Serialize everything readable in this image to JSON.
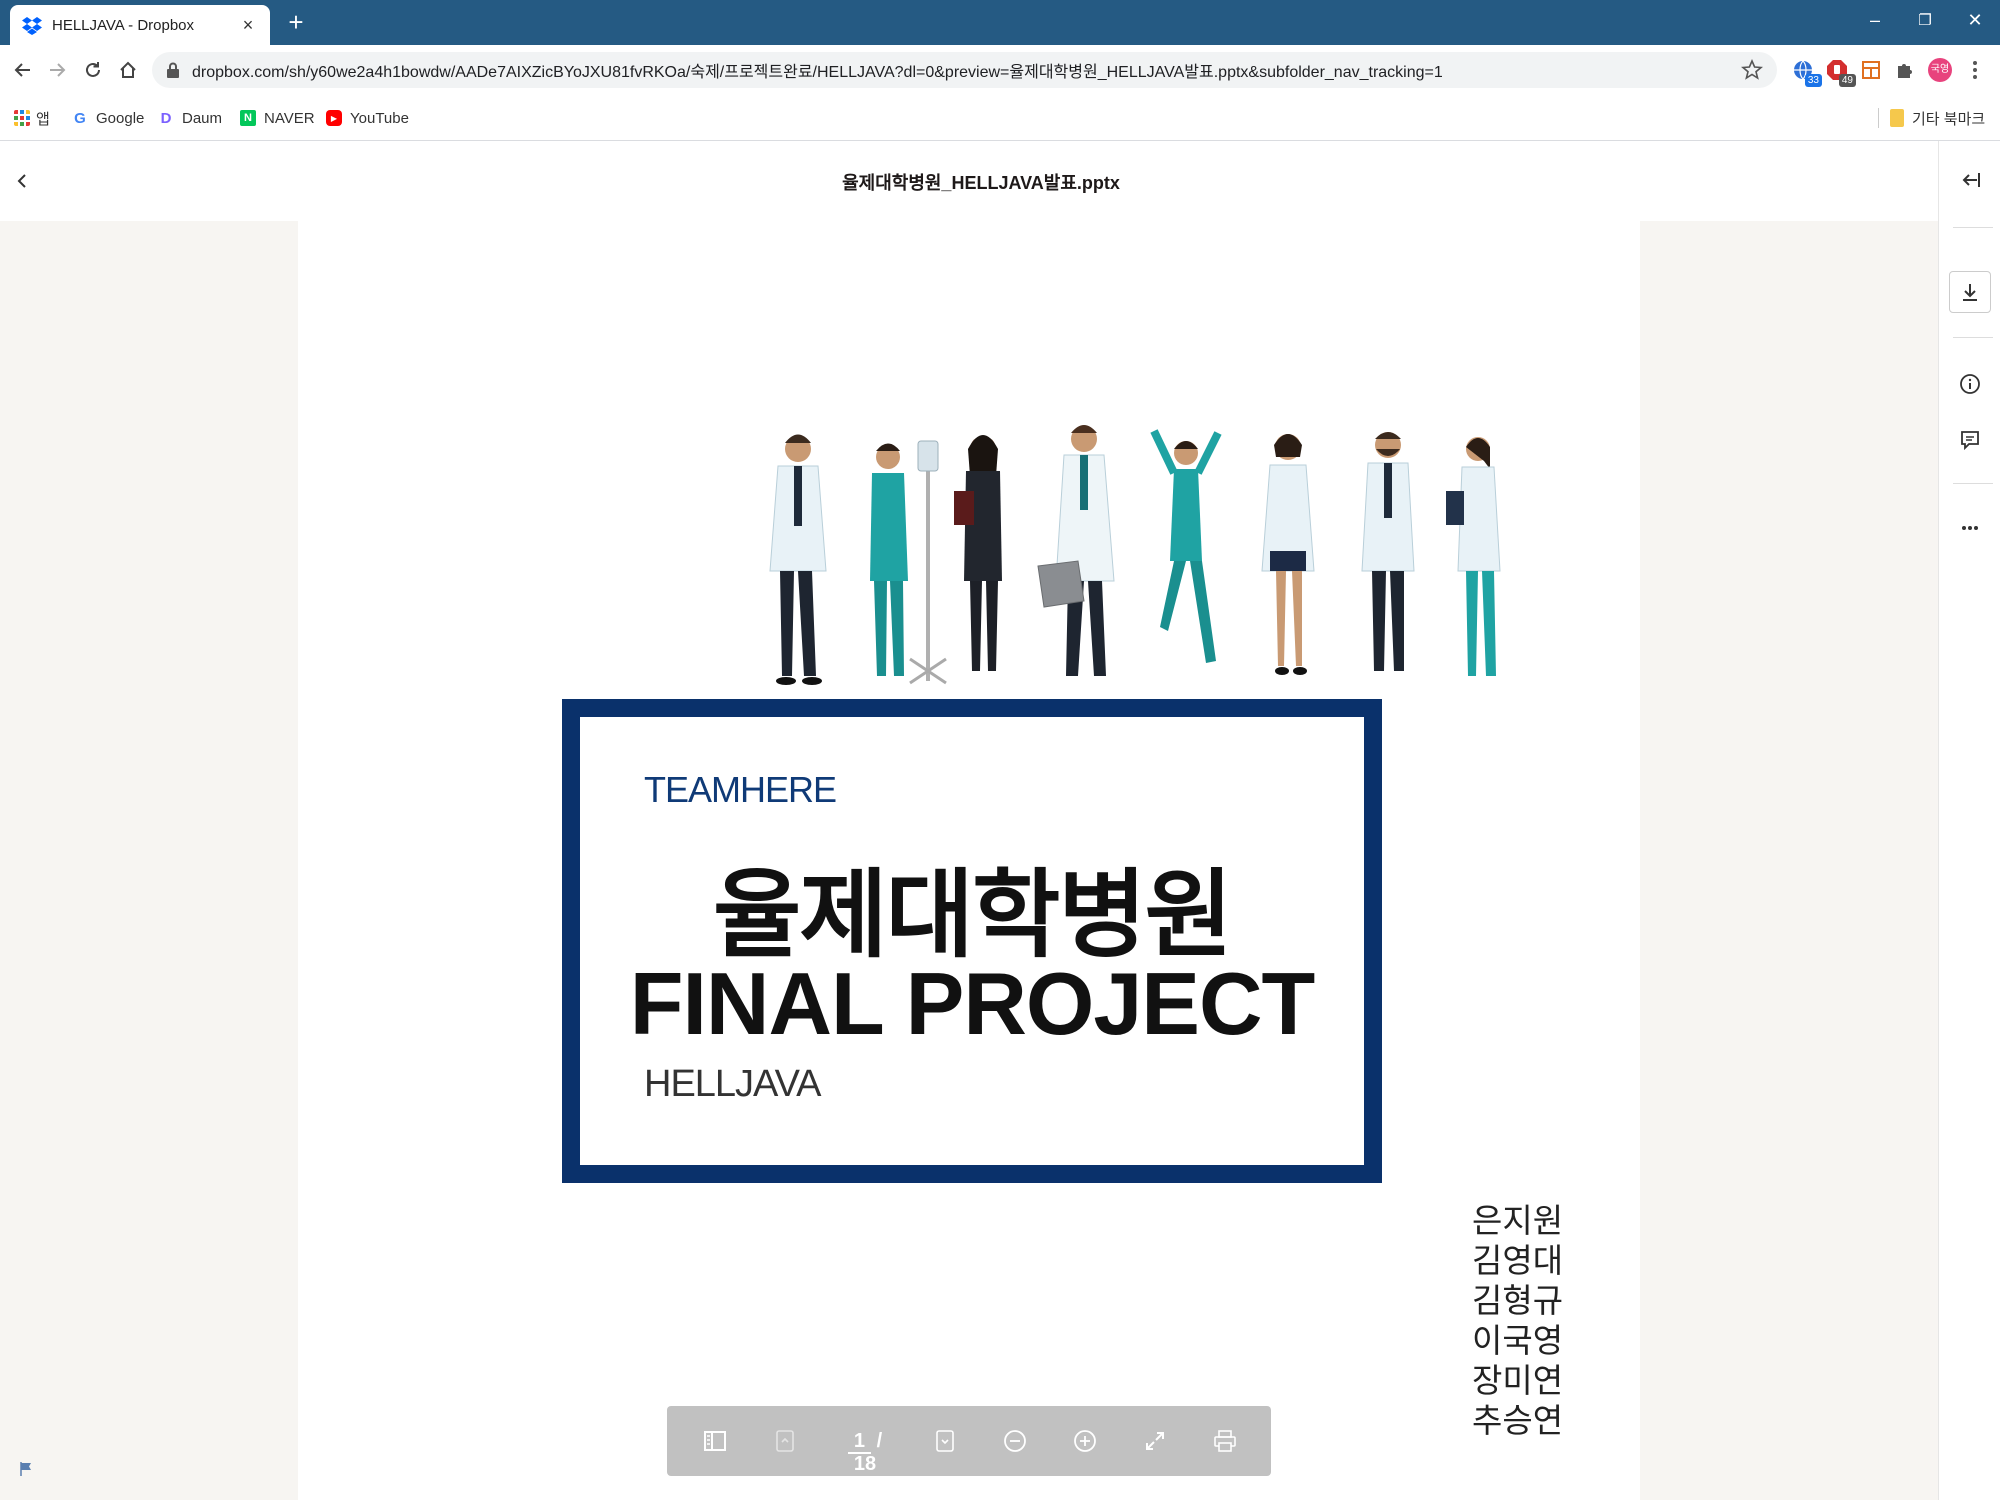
{
  "browser": {
    "tab_title": "HELLJAVA - Dropbox",
    "tab_close": "×",
    "new_tab": "+",
    "url": "dropbox.com/sh/y60we2a4h1bowdw/AADe7AIXZicBYoJXU81fvRKOa/숙제/프로젝트완료/HELLJAVA?dl=0&preview=율제대학병원_HELLJAVA발표.pptx&subfolder_nav_tracking=1",
    "extension_badges": [
      "33",
      "49"
    ],
    "profile_label": "국영",
    "window_controls": {
      "minimize": "–",
      "restore": "❐",
      "close": "✕"
    }
  },
  "bookmarks": {
    "items": [
      {
        "label": "앱",
        "icon": "apps-grid-icon"
      },
      {
        "label": "Google",
        "icon": "google-icon"
      },
      {
        "label": "Daum",
        "icon": "daum-icon"
      },
      {
        "label": "NAVER",
        "icon": "naver-icon"
      },
      {
        "label": "YouTube",
        "icon": "youtube-icon"
      }
    ],
    "other": "기타 북마크"
  },
  "preview": {
    "file_title": "율제대학병원_HELLJAVA발표.pptx"
  },
  "slide": {
    "team": "TEAMHERE",
    "title_korean": "율제대학병원",
    "title_english": "FINAL PROJECT",
    "subtitle": "HELLJAVA",
    "members": [
      "은지원",
      "김영대",
      "김형규",
      "이국영",
      "장미연",
      "추승연"
    ]
  },
  "controls": {
    "current_page": "1",
    "total_pages": "/ 18"
  },
  "colors": {
    "tabbar": "#255a83",
    "slide_border": "#0a316b",
    "teamhere": "#0f3a77",
    "control_bar": "#c1c1c1"
  }
}
